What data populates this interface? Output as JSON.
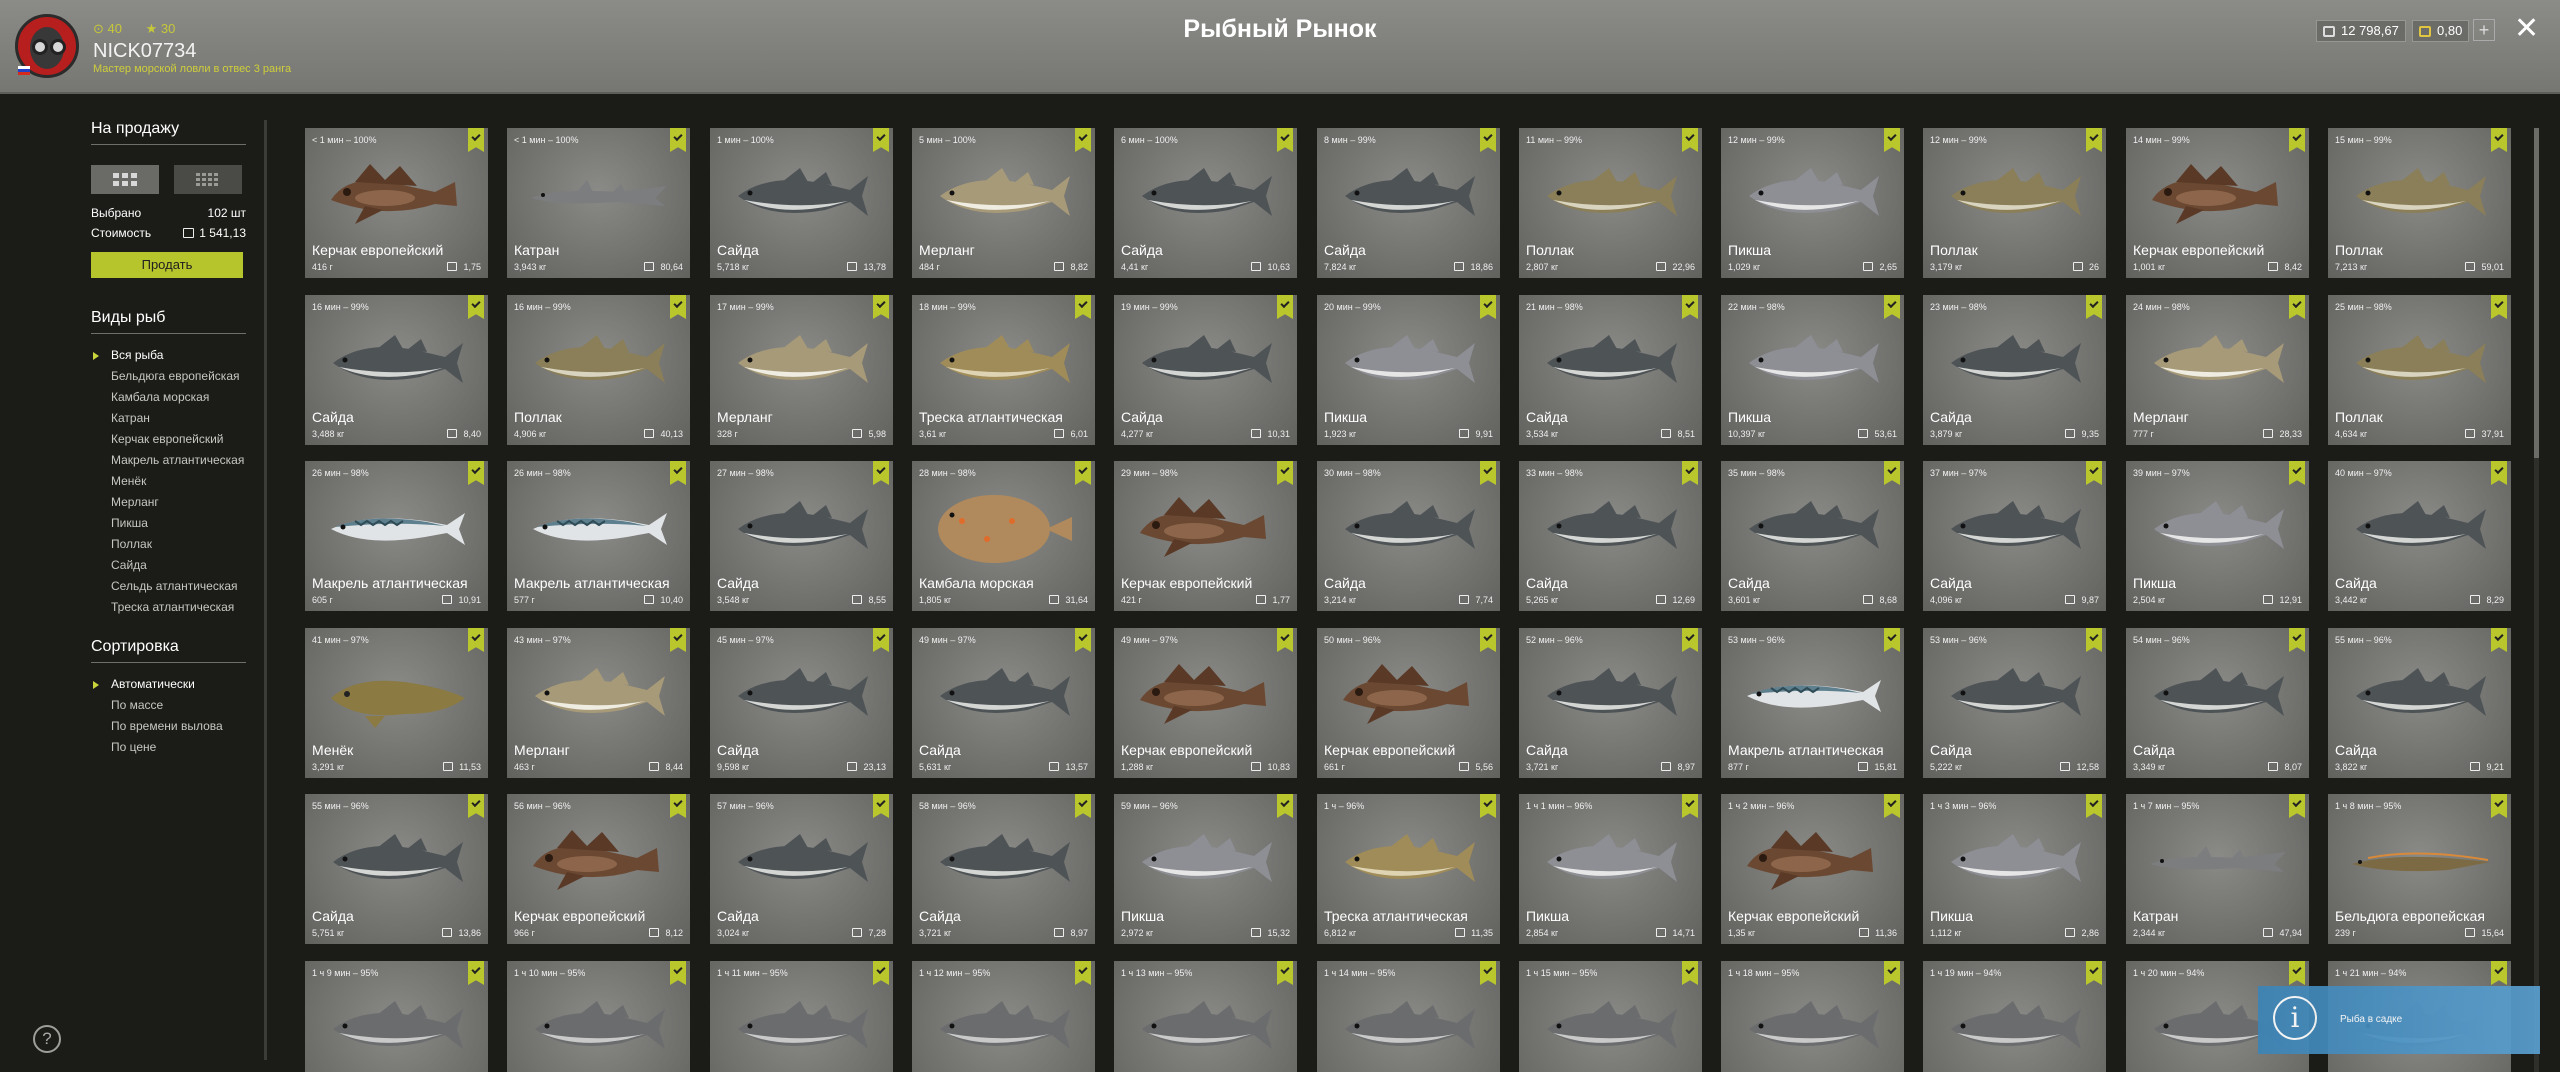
{
  "header": {
    "title": "Рыбный Рынок",
    "player": {
      "nickname": "NICK07734",
      "rank": "Мастер морской ловли в отвес 3 ранга",
      "resource_a": "40",
      "resource_b": "30"
    },
    "balance_silver": "12 798,67",
    "balance_gold": "0,80",
    "plus_label": "+",
    "close_label": "✕"
  },
  "sidebar": {
    "sale_title": "На продажу",
    "selected_label": "Выбрано",
    "selected_value": "102 шт",
    "cost_label": "Стоимость",
    "cost_value": "1 541,13",
    "sell_label": "Продать",
    "species_title": "Виды рыб",
    "species": [
      "Вся рыба",
      "Бельдюга европейская",
      "Камбала морская",
      "Катран",
      "Керчак европейский",
      "Макрель атлантическая",
      "Менёк",
      "Мерланг",
      "Пикша",
      "Поллак",
      "Сайда",
      "Сельдь атлантическая",
      "Треска атлантическая"
    ],
    "sort_title": "Сортировка",
    "sort_options": [
      "Автоматически",
      "По массе",
      "По времени вылова",
      "По цене"
    ],
    "help": "?"
  },
  "toast": {
    "icon": "i",
    "text": "Рыба в садке"
  },
  "colors": {
    "accent": "#b9c72d",
    "card_bg": "#777774",
    "topbar": "#808080",
    "toast": "#4a94c8"
  },
  "fish": [
    {
      "time": "< 1 мин – 100%",
      "name": "Керчак европейский",
      "weight": "416 г",
      "price": "1,75"
    },
    {
      "time": "< 1 мин – 100%",
      "name": "Катран",
      "weight": "3,943 кг",
      "price": "80,64"
    },
    {
      "time": "1 мин – 100%",
      "name": "Сайда",
      "weight": "5,718 кг",
      "price": "13,78"
    },
    {
      "time": "5 мин – 100%",
      "name": "Мерланг",
      "weight": "484 г",
      "price": "8,82"
    },
    {
      "time": "6 мин – 100%",
      "name": "Сайда",
      "weight": "4,41 кг",
      "price": "10,63"
    },
    {
      "time": "8 мин – 99%",
      "name": "Сайда",
      "weight": "7,824 кг",
      "price": "18,86"
    },
    {
      "time": "11 мин – 99%",
      "name": "Поллак",
      "weight": "2,807 кг",
      "price": "22,96"
    },
    {
      "time": "12 мин – 99%",
      "name": "Пикша",
      "weight": "1,029 кг",
      "price": "2,65"
    },
    {
      "time": "12 мин – 99%",
      "name": "Поллак",
      "weight": "3,179 кг",
      "price": "26"
    },
    {
      "time": "14 мин – 99%",
      "name": "Керчак европейский",
      "weight": "1,001 кг",
      "price": "8,42"
    },
    {
      "time": "15 мин – 99%",
      "name": "Поллак",
      "weight": "7,213 кг",
      "price": "59,01"
    },
    {
      "time": "16 мин – 99%",
      "name": "Сайда",
      "weight": "3,488 кг",
      "price": "8,40"
    },
    {
      "time": "16 мин – 99%",
      "name": "Поллак",
      "weight": "4,906 кг",
      "price": "40,13"
    },
    {
      "time": "17 мин – 99%",
      "name": "Мерланг",
      "weight": "328 г",
      "price": "5,98"
    },
    {
      "time": "18 мин – 99%",
      "name": "Треска атлантическая",
      "weight": "3,61 кг",
      "price": "6,01"
    },
    {
      "time": "19 мин – 99%",
      "name": "Сайда",
      "weight": "4,277 кг",
      "price": "10,31"
    },
    {
      "time": "20 мин – 99%",
      "name": "Пикша",
      "weight": "1,923 кг",
      "price": "9,91"
    },
    {
      "time": "21 мин – 98%",
      "name": "Сайда",
      "weight": "3,534 кг",
      "price": "8,51"
    },
    {
      "time": "22 мин – 98%",
      "name": "Пикша",
      "weight": "10,397 кг",
      "price": "53,61"
    },
    {
      "time": "23 мин – 98%",
      "name": "Сайда",
      "weight": "3,879 кг",
      "price": "9,35"
    },
    {
      "time": "24 мин – 98%",
      "name": "Мерланг",
      "weight": "777 г",
      "price": "28,33"
    },
    {
      "time": "25 мин – 98%",
      "name": "Поллак",
      "weight": "4,634 кг",
      "price": "37,91"
    },
    {
      "time": "26 мин – 98%",
      "name": "Макрель атлантическая",
      "weight": "605 г",
      "price": "10,91"
    },
    {
      "time": "26 мин – 98%",
      "name": "Макрель атлантическая",
      "weight": "577 г",
      "price": "10,40"
    },
    {
      "time": "27 мин – 98%",
      "name": "Сайда",
      "weight": "3,548 кг",
      "price": "8,55"
    },
    {
      "time": "28 мин – 98%",
      "name": "Камбала морская",
      "weight": "1,805 кг",
      "price": "31,64"
    },
    {
      "time": "29 мин – 98%",
      "name": "Керчак европейский",
      "weight": "421 г",
      "price": "1,77"
    },
    {
      "time": "30 мин – 98%",
      "name": "Сайда",
      "weight": "3,214 кг",
      "price": "7,74"
    },
    {
      "time": "33 мин – 98%",
      "name": "Сайда",
      "weight": "5,265 кг",
      "price": "12,69"
    },
    {
      "time": "35 мин – 98%",
      "name": "Сайда",
      "weight": "3,601 кг",
      "price": "8,68"
    },
    {
      "time": "37 мин – 97%",
      "name": "Сайда",
      "weight": "4,096 кг",
      "price": "9,87"
    },
    {
      "time": "39 мин – 97%",
      "name": "Пикша",
      "weight": "2,504 кг",
      "price": "12,91"
    },
    {
      "time": "40 мин – 97%",
      "name": "Сайда",
      "weight": "3,442 кг",
      "price": "8,29"
    },
    {
      "time": "41 мин – 97%",
      "name": "Менёк",
      "weight": "3,291 кг",
      "price": "11,53"
    },
    {
      "time": "43 мин – 97%",
      "name": "Мерланг",
      "weight": "463 г",
      "price": "8,44"
    },
    {
      "time": "45 мин – 97%",
      "name": "Сайда",
      "weight": "9,598 кг",
      "price": "23,13"
    },
    {
      "time": "49 мин – 97%",
      "name": "Сайда",
      "weight": "5,631 кг",
      "price": "13,57"
    },
    {
      "time": "49 мин – 97%",
      "name": "Керчак европейский",
      "weight": "1,288 кг",
      "price": "10,83"
    },
    {
      "time": "50 мин – 96%",
      "name": "Керчак европейский",
      "weight": "661 г",
      "price": "5,56"
    },
    {
      "time": "52 мин – 96%",
      "name": "Сайда",
      "weight": "3,721 кг",
      "price": "8,97"
    },
    {
      "time": "53 мин – 96%",
      "name": "Макрель атлантическая",
      "weight": "877 г",
      "price": "15,81"
    },
    {
      "time": "53 мин – 96%",
      "name": "Сайда",
      "weight": "5,222 кг",
      "price": "12,58"
    },
    {
      "time": "54 мин – 96%",
      "name": "Сайда",
      "weight": "3,349 кг",
      "price": "8,07"
    },
    {
      "time": "55 мин – 96%",
      "name": "Сайда",
      "weight": "3,822 кг",
      "price": "9,21"
    },
    {
      "time": "55 мин – 96%",
      "name": "Сайда",
      "weight": "5,751 кг",
      "price": "13,86"
    },
    {
      "time": "56 мин – 96%",
      "name": "Керчак европейский",
      "weight": "966 г",
      "price": "8,12"
    },
    {
      "time": "57 мин – 96%",
      "name": "Сайда",
      "weight": "3,024 кг",
      "price": "7,28"
    },
    {
      "time": "58 мин – 96%",
      "name": "Сайда",
      "weight": "3,721 кг",
      "price": "8,97"
    },
    {
      "time": "59 мин – 96%",
      "name": "Пикша",
      "weight": "2,972 кг",
      "price": "15,32"
    },
    {
      "time": "1 ч – 96%",
      "name": "Треска атлантическая",
      "weight": "6,812 кг",
      "price": "11,35"
    },
    {
      "time": "1 ч 1 мин – 96%",
      "name": "Пикша",
      "weight": "2,854 кг",
      "price": "14,71"
    },
    {
      "time": "1 ч 2 мин – 96%",
      "name": "Керчак европейский",
      "weight": "1,35 кг",
      "price": "11,36"
    },
    {
      "time": "1 ч 3 мин – 96%",
      "name": "Пикша",
      "weight": "1,112 кг",
      "price": "2,86"
    },
    {
      "time": "1 ч 7 мин – 95%",
      "name": "Катран",
      "weight": "2,344 кг",
      "price": "47,94"
    },
    {
      "time": "1 ч 8 мин – 95%",
      "name": "Бельдюга европейская",
      "weight": "239 г",
      "price": "15,64"
    },
    {
      "time": "1 ч 9 мин – 95%",
      "name": "",
      "weight": "",
      "price": ""
    },
    {
      "time": "1 ч 10 мин – 95%",
      "name": "",
      "weight": "",
      "price": ""
    },
    {
      "time": "1 ч 11 мин – 95%",
      "name": "",
      "weight": "",
      "price": ""
    },
    {
      "time": "1 ч 12 мин – 95%",
      "name": "",
      "weight": "",
      "price": ""
    },
    {
      "time": "1 ч 13 мин – 95%",
      "name": "",
      "weight": "",
      "price": ""
    },
    {
      "time": "1 ч 14 мин – 95%",
      "name": "",
      "weight": "",
      "price": ""
    },
    {
      "time": "1 ч 15 мин – 95%",
      "name": "",
      "weight": "",
      "price": ""
    },
    {
      "time": "1 ч 18 мин – 95%",
      "name": "",
      "weight": "",
      "price": ""
    },
    {
      "time": "1 ч 19 мин – 94%",
      "name": "",
      "weight": "",
      "price": ""
    },
    {
      "time": "1 ч 20 мин – 94%",
      "name": "",
      "weight": "",
      "price": ""
    },
    {
      "time": "1 ч 21 мин – 94%",
      "name": "",
      "weight": "",
      "price": ""
    }
  ]
}
